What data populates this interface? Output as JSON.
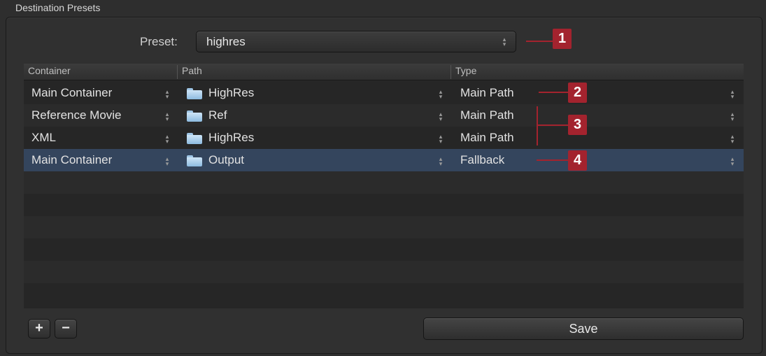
{
  "group_title": "Destination Presets",
  "preset": {
    "label": "Preset:",
    "value": "highres"
  },
  "table": {
    "headers": [
      "Container",
      "Path",
      "Type"
    ],
    "rows": [
      {
        "container": "Main Container",
        "path": "HighRes",
        "type": "Main Path",
        "selected": false
      },
      {
        "container": "Reference Movie",
        "path": "Ref",
        "type": "Main Path",
        "selected": false
      },
      {
        "container": "XML",
        "path": "HighRes",
        "type": "Main Path",
        "selected": false
      },
      {
        "container": "Main Container",
        "path": "Output",
        "type": "Fallback",
        "selected": true
      }
    ]
  },
  "annotations": [
    "1",
    "2",
    "3",
    "4"
  ],
  "annotation_color": "#a3232e",
  "selection_color": "#34455d",
  "buttons": {
    "add": "+",
    "remove": "−",
    "save": "Save"
  },
  "icons": {
    "row_path": "folder-icon",
    "selector": "up-down-stepper-icon"
  }
}
